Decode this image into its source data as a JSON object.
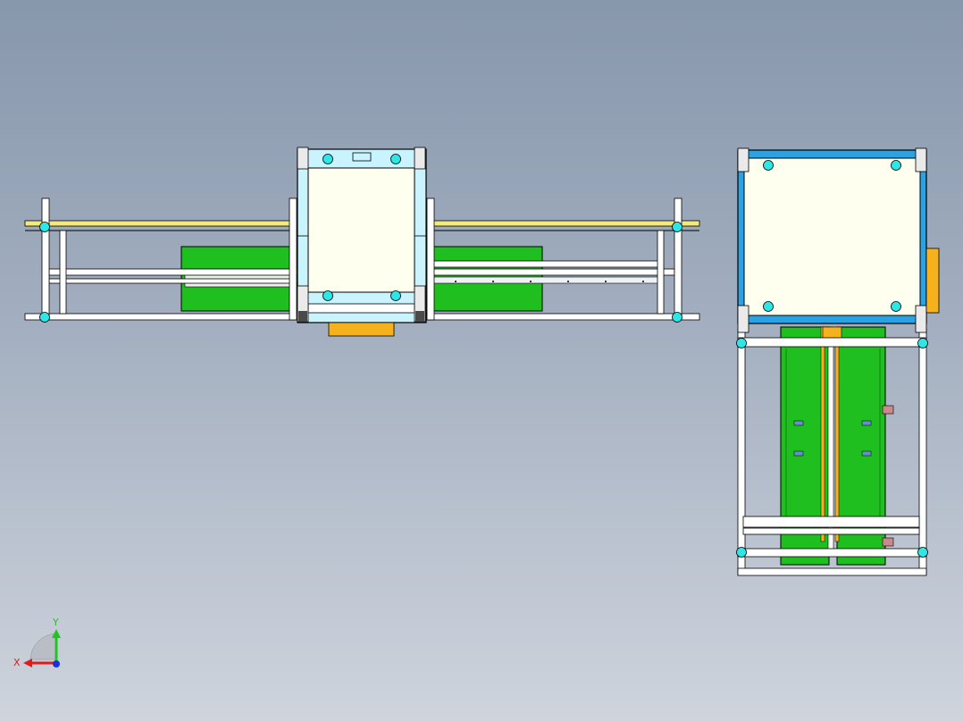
{
  "viewport": {
    "background_top": "#8797ac",
    "background_bottom": "#cfd4dd"
  },
  "colors": {
    "frame": "#ffffff",
    "frame_edge": "#000000",
    "green_belt": "#1fbf1f",
    "cream_panel": "#fffff0",
    "light_cyan_frame": "#c9f3ff",
    "blue_frame": "#29a3e6",
    "orange_part": "#f5b21e",
    "yellow_rail": "#f2ea7a",
    "node": "#2ee6e6"
  },
  "triad": {
    "x_label": "X",
    "y_label": "Y",
    "x_color": "#e01b1b",
    "y_color": "#22c422",
    "z_color": "#1b2fe0"
  }
}
